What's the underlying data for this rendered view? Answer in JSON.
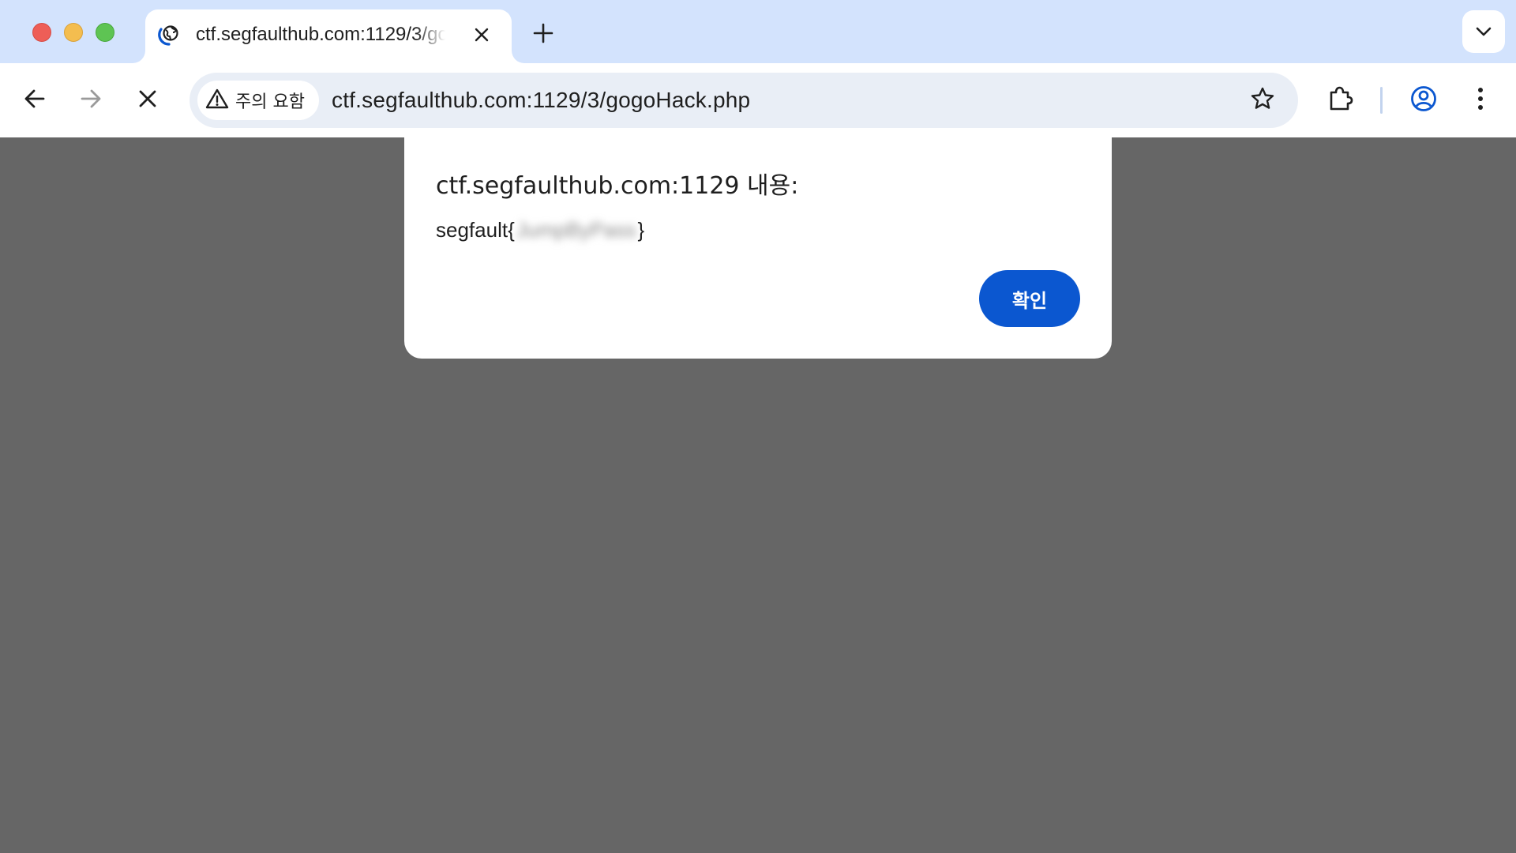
{
  "window": {
    "controls": {
      "close": "close-window",
      "minimize": "minimize-window",
      "zoom": "zoom-window"
    }
  },
  "tab": {
    "title": "ctf.segfaulthub.com:1129/3/gogoHack.php",
    "favicon": "loading-globe-icon",
    "close_icon": "close-icon"
  },
  "tabstrip": {
    "new_tab_icon": "plus-icon",
    "tab_search_icon": "chevron-down-icon"
  },
  "toolbar": {
    "back_icon": "arrow-left-icon",
    "forward_icon": "arrow-right-icon",
    "stop_icon": "close-icon",
    "security_chip_label": "주의 요함",
    "security_chip_icon": "warning-triangle-icon",
    "url": "ctf.segfaulthub.com:1129/3/gogoHack.php",
    "bookmark_icon": "star-outline-icon",
    "extensions_icon": "puzzle-icon",
    "profile_icon": "account-circle-icon",
    "menu_icon": "more-vertical-icon"
  },
  "dialog": {
    "title": "ctf.segfaulthub.com:1129 내용:",
    "message_prefix": "segfault{",
    "message_redacted": "JumpByPass",
    "message_suffix": "}",
    "ok_label": "확인"
  },
  "colors": {
    "tabstrip_bg": "#d3e3fd",
    "omnibox_bg": "#e9eef6",
    "page_bg": "#666666",
    "primary_button": "#0b57d0",
    "profile_accent": "#0b57d0"
  }
}
